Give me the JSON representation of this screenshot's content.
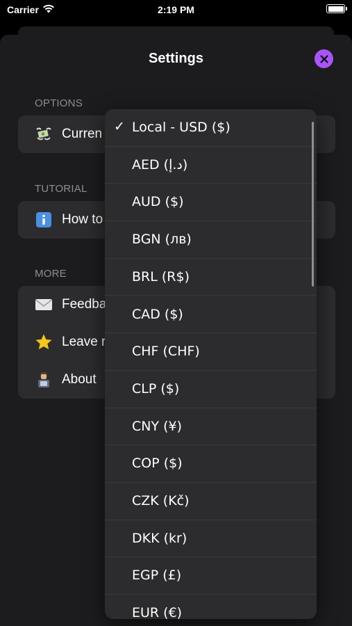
{
  "status_bar": {
    "carrier": "Carrier",
    "time": "2:19 PM",
    "battery_level": 1.0
  },
  "sheet": {
    "title": "Settings"
  },
  "sections": {
    "options": {
      "header": "OPTIONS",
      "rows": [
        {
          "icon": "money-with-wings-icon",
          "label": "Curren"
        }
      ]
    },
    "tutorial": {
      "header": "TUTORIAL",
      "rows": [
        {
          "icon": "info-icon",
          "label": "How to"
        }
      ]
    },
    "more": {
      "header": "MORE",
      "rows": [
        {
          "icon": "envelope-icon",
          "label": "Feedba"
        },
        {
          "icon": "star-icon",
          "label": "Leave r"
        },
        {
          "icon": "developer-icon",
          "label": "About"
        }
      ]
    }
  },
  "currency_menu": {
    "items": [
      {
        "label": "Local - USD ($)",
        "selected": true,
        "check": "✓"
      },
      {
        "label": "AED (د.إ)"
      },
      {
        "label": "AUD ($)"
      },
      {
        "label": "BGN (лв)"
      },
      {
        "label": "BRL (R$)"
      },
      {
        "label": "CAD ($)"
      },
      {
        "label": "CHF (CHF)"
      },
      {
        "label": "CLP ($)"
      },
      {
        "label": "CNY (¥)"
      },
      {
        "label": "COP ($)"
      },
      {
        "label": "CZK (Kč)"
      },
      {
        "label": "DKK (kr)"
      },
      {
        "label": "EGP (£)"
      },
      {
        "label": "EUR (€)"
      }
    ]
  },
  "colors": {
    "accent": "#a855f7",
    "sheet_bg": "#1c1c1e",
    "group_bg": "#2c2c2e",
    "header_text": "#8e8e93"
  }
}
